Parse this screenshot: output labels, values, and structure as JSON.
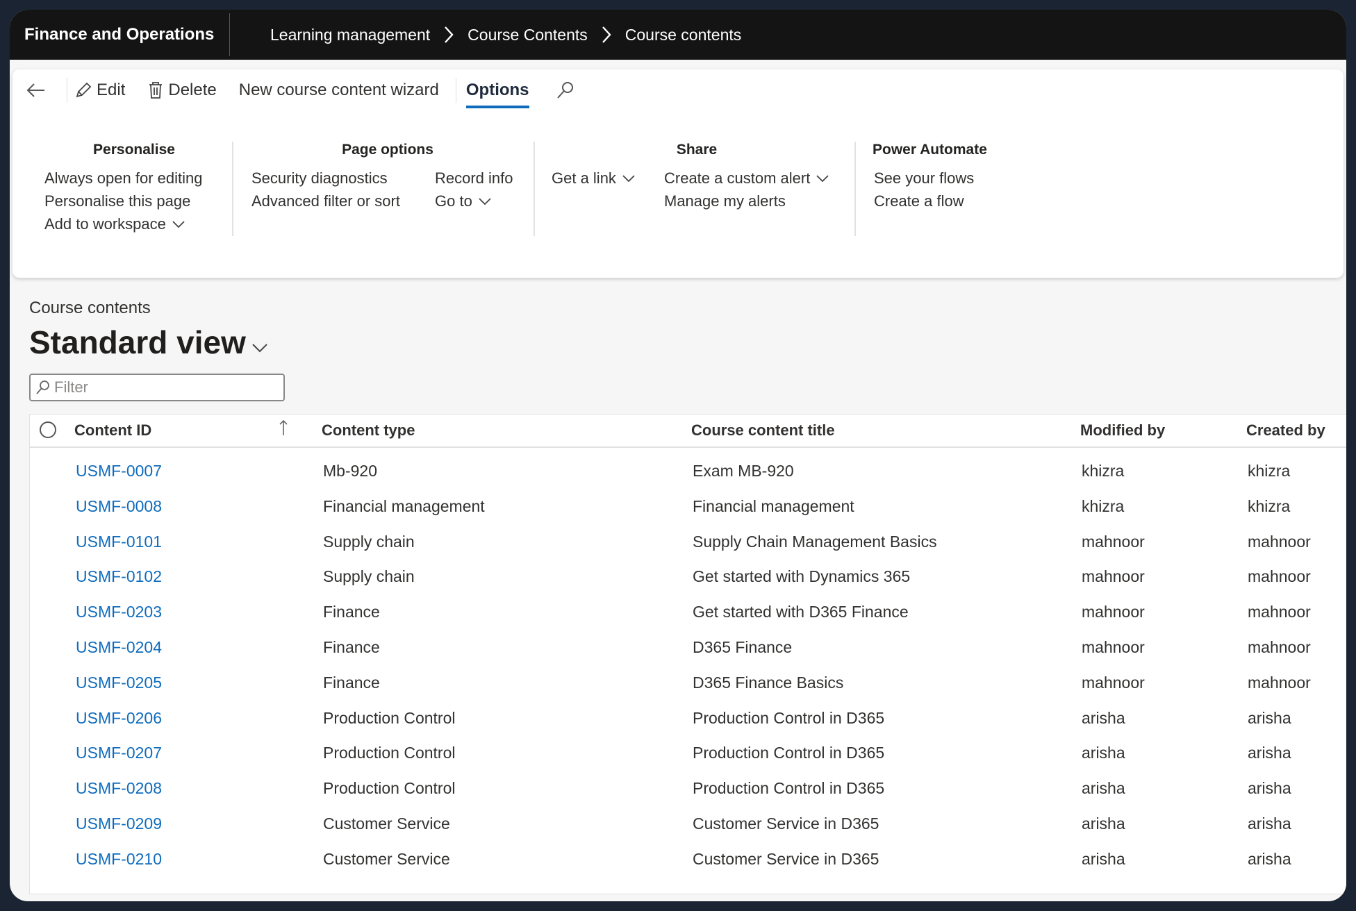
{
  "app": {
    "title": "Finance and Operations"
  },
  "breadcrumb": [
    "Learning management",
    "Course Contents",
    "Course contents"
  ],
  "toolbar": {
    "edit": "Edit",
    "delete": "Delete",
    "wizard": "New course content wizard",
    "options": "Options"
  },
  "ribbon": {
    "personalise": {
      "title": "Personalise",
      "items": [
        "Always open for editing",
        "Personalise this page",
        "Add to workspace"
      ]
    },
    "page_options": {
      "title": "Page options",
      "col1": [
        "Security diagnostics",
        "Advanced filter or sort"
      ],
      "col2": [
        "Record info",
        "Go to"
      ]
    },
    "share": {
      "title": "Share",
      "get_link": "Get a link",
      "alerts": [
        "Create a custom alert",
        "Manage my alerts"
      ]
    },
    "power_automate": {
      "title": "Power Automate",
      "items": [
        "See your flows",
        "Create a flow"
      ]
    }
  },
  "page": {
    "label": "Course contents",
    "view": "Standard view",
    "filter_placeholder": "Filter"
  },
  "grid": {
    "columns": [
      "Content ID",
      "Content type",
      "Course content title",
      "Modified by",
      "Created by"
    ],
    "rows": [
      [
        "USMF-0007",
        "Mb-920",
        "Exam MB-920",
        "khizra",
        "khizra"
      ],
      [
        "USMF-0008",
        "Financial management",
        "Financial management",
        "khizra",
        "khizra"
      ],
      [
        "USMF-0101",
        "Supply chain",
        "Supply Chain Management Basics",
        "mahnoor",
        "mahnoor"
      ],
      [
        "USMF-0102",
        "Supply chain",
        "Get started with Dynamics 365",
        "mahnoor",
        "mahnoor"
      ],
      [
        "USMF-0203",
        "Finance",
        "Get started with D365 Finance",
        "mahnoor",
        "mahnoor"
      ],
      [
        "USMF-0204",
        "Finance",
        "D365 Finance",
        "mahnoor",
        "mahnoor"
      ],
      [
        "USMF-0205",
        "Finance",
        "D365 Finance Basics",
        "mahnoor",
        "mahnoor"
      ],
      [
        "USMF-0206",
        "Production Control",
        "Production Control in D365",
        "arisha",
        "arisha"
      ],
      [
        "USMF-0207",
        "Production Control",
        "Production Control in D365",
        "arisha",
        "arisha"
      ],
      [
        "USMF-0208",
        "Production Control",
        "Production Control in D365",
        "arisha",
        "arisha"
      ],
      [
        "USMF-0209",
        "Customer Service",
        "Customer Service in D365",
        "arisha",
        "arisha"
      ],
      [
        "USMF-0210",
        "Customer Service",
        "Customer Service in D365",
        "arisha",
        "arisha"
      ]
    ]
  },
  "colors": {
    "accent": "#0f6cbd",
    "topbar": "#141414"
  }
}
